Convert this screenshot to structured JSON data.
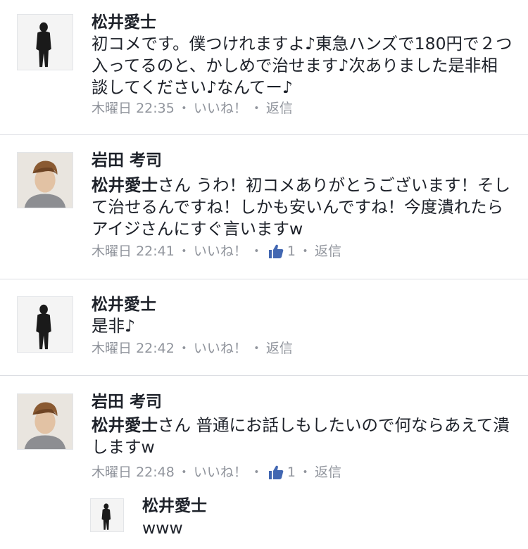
{
  "comments": [
    {
      "author": "松井愛士",
      "mention": "",
      "text": "初コメです。僕つけれますよ♪東急ハンズで180円で２つ入ってるのと、かしめで治せます♪次ありました是非相談してください♪なんてー♪",
      "day": "木曜日",
      "time": "22:35",
      "like_label": "いいね！",
      "like_count": "",
      "reply_label": "返信"
    },
    {
      "author": "岩田 考司",
      "mention": "松井愛士",
      "text": "さん うわ！初コメありがとうございます！そして治せるんですね！しかも安いんですね！今度潰れたらアイジさんにすぐ言いますw",
      "day": "木曜日",
      "time": "22:41",
      "like_label": "いいね！",
      "like_count": "1",
      "reply_label": "返信"
    },
    {
      "author": "松井愛士",
      "mention": "",
      "text": "是非♪",
      "day": "木曜日",
      "time": "22:42",
      "like_label": "いいね！",
      "like_count": "",
      "reply_label": "返信"
    },
    {
      "author": "岩田 考司",
      "mention": "松井愛士",
      "text": "さん 普通にお話しもしたいので何ならあえて潰しますw",
      "day": "木曜日",
      "time": "22:48",
      "like_label": "いいね！",
      "like_count": "1",
      "reply_label": "返信"
    }
  ],
  "reply": {
    "author": "松井愛士",
    "text": "www"
  },
  "meta": {
    "separator": "・"
  },
  "colors": {
    "text": "#1d2129",
    "meta": "#90949c",
    "divider": "#dcdee3",
    "like_icon": "#4267b2"
  }
}
